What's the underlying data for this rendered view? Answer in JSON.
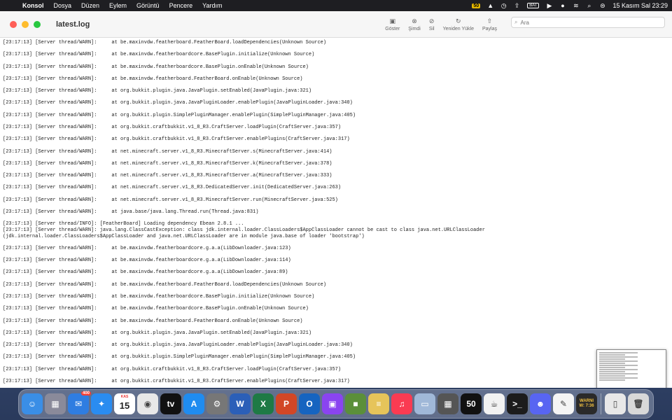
{
  "menubar": {
    "app_name": "Konsol",
    "items": [
      "Dosya",
      "Düzen",
      "Eylem",
      "Görüntü",
      "Pencere",
      "Yardım"
    ],
    "status_icons": [
      "50-badge-icon",
      "drive-icon",
      "clock-icon",
      "upload-icon",
      "battery-icon",
      "play-icon",
      "user-icon",
      "wifi-icon",
      "search-icon",
      "control-center-icon"
    ],
    "status_badge": "50",
    "battery_label": "BAT",
    "datetime": "15 Kasım Sal  23:29"
  },
  "window": {
    "title": "latest.log",
    "toolbar": [
      {
        "icon": "show-icon",
        "label": "Göster"
      },
      {
        "icon": "now-icon",
        "label": "Şimdi"
      },
      {
        "icon": "clear-icon",
        "label": "Sil"
      },
      {
        "icon": "reload-icon",
        "label": "Yeniden Yükle"
      },
      {
        "icon": "share-icon",
        "label": "Paylaş"
      }
    ],
    "search_placeholder": "Ara"
  },
  "log_lines": [
    "[23:17:13] [Server thread/WARN]:     at be.maxinvdw.featherboard.FeatherBoard.loadDependencies(Unknown Source)",
    "[23:17:13] [Server thread/WARN]:     at be.maxinvdw.featherboardcore.BasePlugin.initialize(Unknown Source)",
    "[23:17:13] [Server thread/WARN]:     at be.maxinvdw.featherboardcore.BasePlugin.onEnable(Unknown Source)",
    "[23:17:13] [Server thread/WARN]:     at be.maxinvdw.featherboard.FeatherBoard.onEnable(Unknown Source)",
    "[23:17:13] [Server thread/WARN]:     at org.bukkit.plugin.java.JavaPlugin.setEnabled(JavaPlugin.java:321)",
    "[23:17:13] [Server thread/WARN]:     at org.bukkit.plugin.java.JavaPluginLoader.enablePlugin(JavaPluginLoader.java:340)",
    "[23:17:13] [Server thread/WARN]:     at org.bukkit.plugin.SimplePluginManager.enablePlugin(SimplePluginManager.java:405)",
    "[23:17:13] [Server thread/WARN]:     at org.bukkit.craftbukkit.v1_8_R3.CraftServer.loadPlugin(CraftServer.java:357)",
    "[23:17:13] [Server thread/WARN]:     at org.bukkit.craftbukkit.v1_8_R3.CraftServer.enablePlugins(CraftServer.java:317)",
    "[23:17:13] [Server thread/WARN]:     at net.minecraft.server.v1_8_R3.MinecraftServer.s(MinecraftServer.java:414)",
    "[23:17:13] [Server thread/WARN]:     at net.minecraft.server.v1_8_R3.MinecraftServer.k(MinecraftServer.java:378)",
    "[23:17:13] [Server thread/WARN]:     at net.minecraft.server.v1_8_R3.MinecraftServer.a(MinecraftServer.java:333)",
    "[23:17:13] [Server thread/WARN]:     at net.minecraft.server.v1_8_R3.DedicatedServer.init(DedicatedServer.java:263)",
    "[23:17:13] [Server thread/WARN]:     at net.minecraft.server.v1_8_R3.MinecraftServer.run(MinecraftServer.java:525)",
    "[23:17:13] [Server thread/WARN]:     at java.base/java.lang.Thread.run(Thread.java:831)",
    "[23:17:13] [Server thread/INFO]: [FeatherBoard] Loading dependency Ebean 2.8.1 ...",
    "[23:17:13] [Server thread/WARN]: java.lang.ClassCastException: class jdk.internal.loader.ClassLoaders$AppClassLoader cannot be cast to class java.net.URLClassLoader",
    "(jdk.internal.loader.ClassLoaders$AppClassLoader and java.net.URLClassLoader are in module java.base of loader 'bootstrap')",
    "[23:17:13] [Server thread/WARN]:     at be.maxinvdw.featherboardcore.g.a.a(LibDownloader.java:123)",
    "[23:17:13] [Server thread/WARN]:     at be.maxinvdw.featherboardcore.g.a.a(LibDownloader.java:114)",
    "[23:17:13] [Server thread/WARN]:     at be.maxinvdw.featherboardcore.g.a.a(LibDownloader.java:89)",
    "[23:17:13] [Server thread/WARN]:     at be.maxinvdw.featherboard.FeatherBoard.loadDependencies(Unknown Source)",
    "[23:17:13] [Server thread/WARN]:     at be.maxinvdw.featherboardcore.BasePlugin.initialize(Unknown Source)",
    "[23:17:13] [Server thread/WARN]:     at be.maxinvdw.featherboardcore.BasePlugin.onEnable(Unknown Source)",
    "[23:17:13] [Server thread/WARN]:     at be.maxinvdw.featherboard.FeatherBoard.onEnable(Unknown Source)",
    "[23:17:13] [Server thread/WARN]:     at org.bukkit.plugin.java.JavaPlugin.setEnabled(JavaPlugin.java:321)",
    "[23:17:13] [Server thread/WARN]:     at org.bukkit.plugin.java.JavaPluginLoader.enablePlugin(JavaPluginLoader.java:340)",
    "[23:17:13] [Server thread/WARN]:     at org.bukkit.plugin.SimplePluginManager.enablePlugin(SimplePluginManager.java:405)",
    "[23:17:13] [Server thread/WARN]:     at org.bukkit.craftbukkit.v1_8_R3.CraftServer.loadPlugin(CraftServer.java:357)",
    "[23:17:13] [Server thread/WARN]:     at org.bukkit.craftbukkit.v1_8_R3.CraftServer.enablePlugins(CraftServer.java:317)"
  ],
  "dock": {
    "calendar_month": "KAS",
    "calendar_day": "15",
    "mail_badge": "400",
    "apps": [
      {
        "name": "finder",
        "icon": "finder-icon",
        "color": "#3a8ee6",
        "glyph": "☺"
      },
      {
        "name": "launchpad",
        "icon": "launchpad-icon",
        "color": "#8a8a9a",
        "glyph": "▦"
      },
      {
        "name": "mail",
        "icon": "mail-icon",
        "color": "#2f7de1",
        "glyph": "✉"
      },
      {
        "name": "safari",
        "icon": "safari-icon",
        "color": "#2a8cf0",
        "glyph": "✦"
      },
      {
        "name": "calendar",
        "icon": "calendar-icon",
        "color": "#ffffff",
        "glyph": ""
      },
      {
        "name": "chrome",
        "icon": "chrome-icon",
        "color": "#e8e8e8",
        "glyph": "◉"
      },
      {
        "name": "apple-tv",
        "icon": "tv-icon",
        "color": "#111111",
        "glyph": "tv"
      },
      {
        "name": "app-store",
        "icon": "app-store-icon",
        "color": "#1f8cf0",
        "glyph": "A"
      },
      {
        "name": "system-settings",
        "icon": "gear-icon",
        "color": "#777777",
        "glyph": "⚙"
      },
      {
        "name": "word",
        "icon": "word-icon",
        "color": "#2b5fb8",
        "glyph": "W"
      },
      {
        "name": "excel",
        "icon": "excel-icon",
        "color": "#1e7a45",
        "glyph": "X"
      },
      {
        "name": "powerpoint",
        "icon": "powerpoint-icon",
        "color": "#d24726",
        "glyph": "P"
      },
      {
        "name": "outlook",
        "icon": "outlook-icon",
        "color": "#1664c0",
        "glyph": "O"
      },
      {
        "name": "twitch",
        "icon": "twitch-icon",
        "color": "#8a44f0",
        "glyph": "▣"
      },
      {
        "name": "minecraft",
        "icon": "minecraft-icon",
        "color": "#5b8f3a",
        "glyph": "■"
      },
      {
        "name": "notes-list",
        "icon": "list-icon",
        "color": "#e6c45a",
        "glyph": "≡"
      },
      {
        "name": "music",
        "icon": "music-icon",
        "color": "#fa3b52",
        "glyph": "♫"
      },
      {
        "name": "preview",
        "icon": "preview-icon",
        "color": "#a0b8d8",
        "glyph": "▭"
      },
      {
        "name": "calculator",
        "icon": "calculator-icon",
        "color": "#555555",
        "glyph": "▦"
      },
      {
        "name": "fifty-app",
        "icon": "50-badge-icon",
        "color": "#111111",
        "glyph": "50"
      },
      {
        "name": "java",
        "icon": "java-icon",
        "color": "#f2f2f2",
        "glyph": "☕"
      },
      {
        "name": "terminal",
        "icon": "terminal-icon",
        "color": "#1c1c1c",
        "glyph": ">_"
      },
      {
        "name": "discord",
        "icon": "discord-icon",
        "color": "#5865f2",
        "glyph": "☻"
      },
      {
        "name": "textedit",
        "icon": "textedit-icon",
        "color": "#f4f4f4",
        "glyph": "✎"
      },
      {
        "name": "console",
        "icon": "console-icon",
        "color": "#2a2a2a",
        "glyph": ""
      }
    ],
    "console_text_1": "WARNI",
    "console_text_2": "W: 7:36",
    "trailing": [
      {
        "name": "document",
        "icon": "document-icon",
        "color": "#e8e8e8",
        "glyph": "▯"
      },
      {
        "name": "trash",
        "icon": "trash-icon",
        "color": "#d8d8d8",
        "glyph": "🗑"
      }
    ]
  }
}
